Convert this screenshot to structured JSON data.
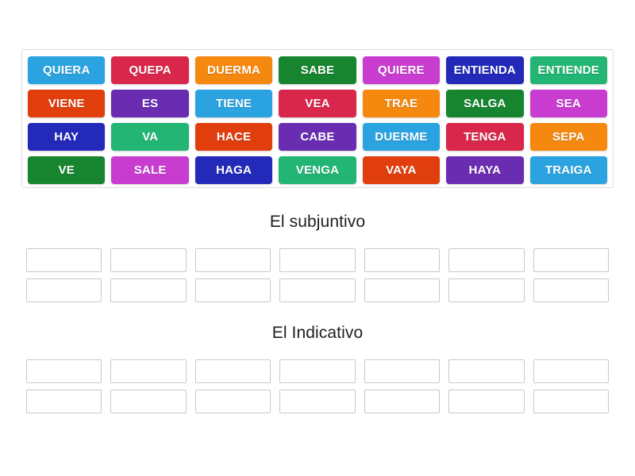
{
  "activity": {
    "type": "group-sort",
    "tile_rows": [
      [
        {
          "label": "QUIERA",
          "color": "#2ba3e0"
        },
        {
          "label": "QUEPA",
          "color": "#d8274a"
        },
        {
          "label": "DUERMA",
          "color": "#f5880e"
        },
        {
          "label": "SABE",
          "color": "#17842f"
        },
        {
          "label": "QUIERE",
          "color": "#c83dd0"
        },
        {
          "label": "ENTIENDA",
          "color": "#2329b8"
        },
        {
          "label": "ENTIENDE",
          "color": "#22b573"
        }
      ],
      [
        {
          "label": "VIENE",
          "color": "#e03e0d"
        },
        {
          "label": "ES",
          "color": "#6a2cb0"
        },
        {
          "label": "TIENE",
          "color": "#2ba3e0"
        },
        {
          "label": "VEA",
          "color": "#d8274a"
        },
        {
          "label": "TRAE",
          "color": "#f5880e"
        },
        {
          "label": "SALGA",
          "color": "#17842f"
        },
        {
          "label": "SEA",
          "color": "#c83dd0"
        }
      ],
      [
        {
          "label": "HAY",
          "color": "#2329b8"
        },
        {
          "label": "VA",
          "color": "#22b573"
        },
        {
          "label": "HACE",
          "color": "#e03e0d"
        },
        {
          "label": "CABE",
          "color": "#6a2cb0"
        },
        {
          "label": "DUERME",
          "color": "#2ba3e0"
        },
        {
          "label": "TENGA",
          "color": "#d8274a"
        },
        {
          "label": "SEPA",
          "color": "#f5880e"
        }
      ],
      [
        {
          "label": "VE",
          "color": "#17842f"
        },
        {
          "label": "SALE",
          "color": "#c83dd0"
        },
        {
          "label": "HAGA",
          "color": "#2329b8"
        },
        {
          "label": "VENGA",
          "color": "#22b573"
        },
        {
          "label": "VAYA",
          "color": "#e03e0d"
        },
        {
          "label": "HAYA",
          "color": "#6a2cb0"
        },
        {
          "label": "TRAIGA",
          "color": "#2ba3e0"
        }
      ]
    ],
    "groups": [
      {
        "title": "El subjuntivo",
        "slot_rows": [
          [
            "",
            "",
            "",
            "",
            "",
            "",
            ""
          ],
          [
            "",
            "",
            "",
            "",
            "",
            "",
            ""
          ]
        ]
      },
      {
        "title": "El Indicativo",
        "slot_rows": [
          [
            "",
            "",
            "",
            "",
            "",
            "",
            ""
          ],
          [
            "",
            "",
            "",
            "",
            "",
            "",
            ""
          ]
        ]
      }
    ]
  }
}
